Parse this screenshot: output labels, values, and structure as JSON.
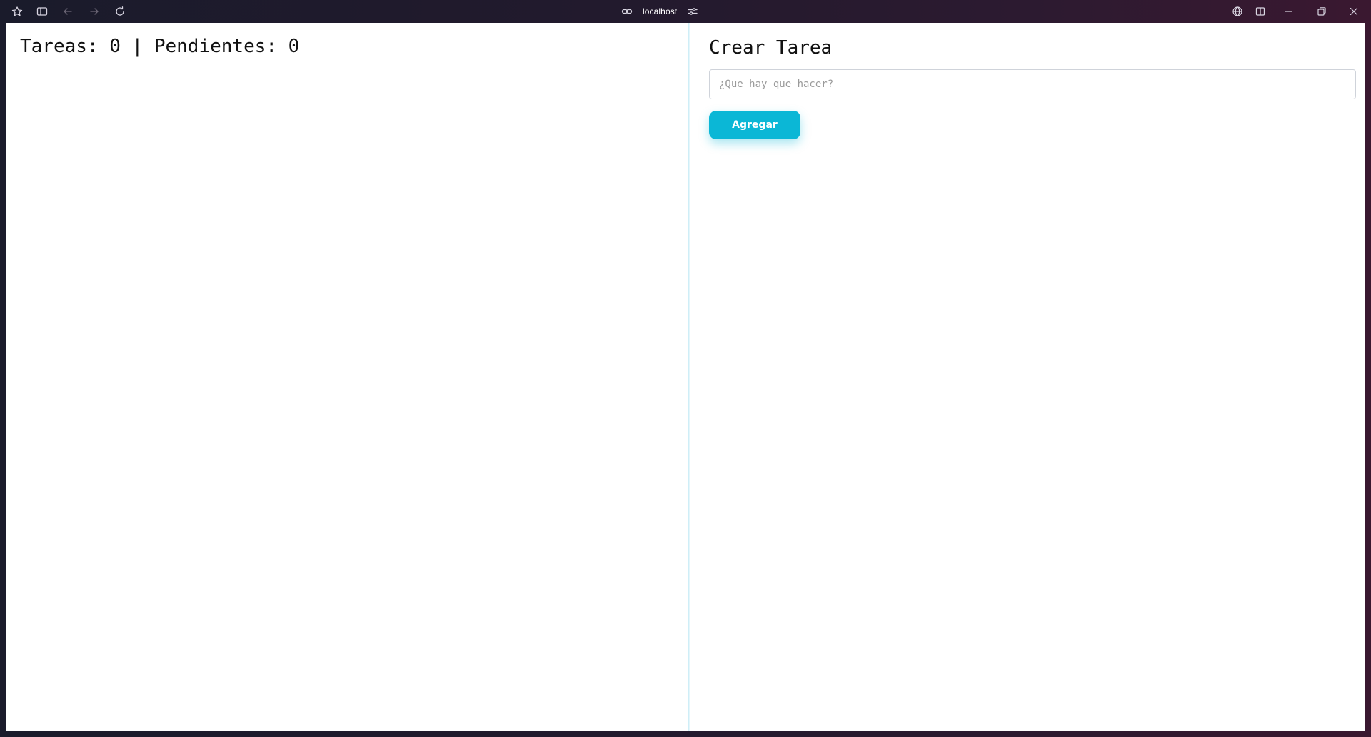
{
  "browser": {
    "url": "localhost",
    "icons": {
      "app": "browser-logo-icon",
      "sidebar": "sidebar-toggle-icon",
      "back": "arrow-left-icon",
      "forward": "arrow-right-icon",
      "reload": "reload-icon",
      "link": "link-icon",
      "site_settings": "sliders-icon",
      "translate": "globe-icon",
      "split": "split-view-icon",
      "minimize": "minimize-icon",
      "restore": "restore-icon",
      "close": "close-icon"
    }
  },
  "tasks_panel": {
    "summary": "Tareas: 0 | Pendientes: 0"
  },
  "create_panel": {
    "title": "Crear Tarea",
    "input": {
      "placeholder": "¿Que hay que hacer?",
      "value": ""
    },
    "add_label": "Agregar"
  },
  "colors": {
    "accent": "#0bb7d6",
    "page_background": "#ffffff",
    "chrome_background": "#221a2d"
  }
}
